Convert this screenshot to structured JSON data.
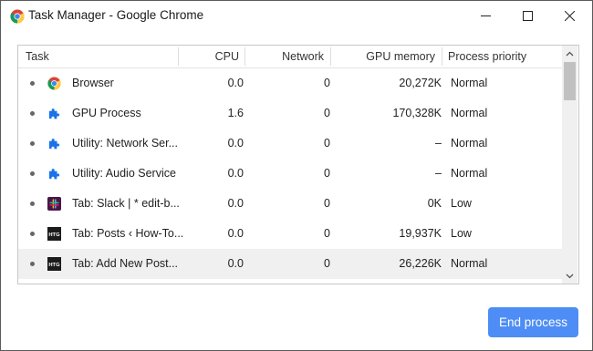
{
  "window": {
    "title": "Task Manager - Google Chrome"
  },
  "table": {
    "columns": [
      "Task",
      "CPU",
      "Network",
      "GPU memory",
      "Process priority"
    ],
    "rows": [
      {
        "icon": "chrome-icon",
        "task": "Browser",
        "cpu": "0.0",
        "network": "0",
        "gpu": "20,272K",
        "priority": "Normal",
        "selected": false
      },
      {
        "icon": "puzzle-icon",
        "task": "GPU Process",
        "cpu": "1.6",
        "network": "0",
        "gpu": "170,328K",
        "priority": "Normal",
        "selected": false
      },
      {
        "icon": "puzzle-icon",
        "task": "Utility: Network Ser...",
        "cpu": "0.0",
        "network": "0",
        "gpu": "–",
        "priority": "Normal",
        "selected": false
      },
      {
        "icon": "puzzle-icon",
        "task": "Utility: Audio Service",
        "cpu": "0.0",
        "network": "0",
        "gpu": "–",
        "priority": "Normal",
        "selected": false
      },
      {
        "icon": "slack-icon",
        "task": "Tab: Slack | * edit-b...",
        "cpu": "0.0",
        "network": "0",
        "gpu": "0K",
        "priority": "Low",
        "selected": false
      },
      {
        "icon": "htg-icon",
        "task": "Tab: Posts ‹ How-To...",
        "cpu": "0.0",
        "network": "0",
        "gpu": "19,937K",
        "priority": "Low",
        "selected": false
      },
      {
        "icon": "htg-icon",
        "task": "Tab: Add New Post...",
        "cpu": "0.0",
        "network": "0",
        "gpu": "26,226K",
        "priority": "Normal",
        "selected": true
      }
    ]
  },
  "actions": {
    "end_process": "End process"
  },
  "colors": {
    "accent": "#4e8df5",
    "puzzle": "#1a73e8",
    "selected_row": "#f0f0f0"
  }
}
